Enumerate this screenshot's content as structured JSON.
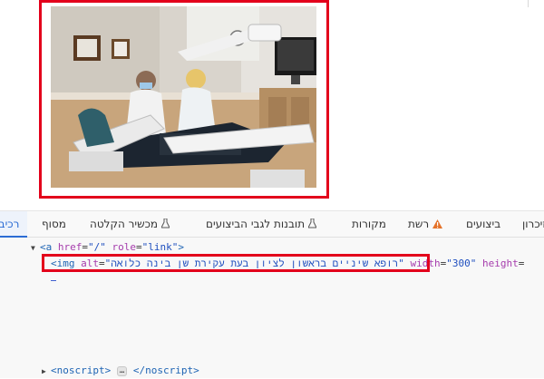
{
  "page": {
    "photo": {
      "description_icon": "dental-clinic-photo"
    }
  },
  "devtools": {
    "tabs": [
      {
        "label": "רכיבי",
        "active": true
      },
      {
        "label": "מסוף"
      },
      {
        "label": "מכשיר הקלטה",
        "icon": "flask-icon"
      },
      {
        "label": "תובנות לגבי הביצועים",
        "icon": "flask-icon"
      },
      {
        "label": "מקורות"
      },
      {
        "label": "רשת",
        "icon": "warning-icon"
      },
      {
        "label": "ביצועים"
      },
      {
        "label": "זיכרון"
      }
    ],
    "dom": {
      "a_line": {
        "tag_open": "<a",
        "href_attr": "href",
        "href_val": "\"/\"",
        "role_attr": "role",
        "role_val": "\"link\"",
        "close": ">"
      },
      "img_line": {
        "tag_open": "<img",
        "alt_attr": "alt",
        "alt_val": "\"רופא שיניים בראשון לציון בעת עקירת שן בינה כלואה\"",
        "width_attr": "width",
        "width_val": "\"300\"",
        "height_attr": "height"
      },
      "noscript_line": {
        "open": "<noscript>",
        "ellipsis": "…",
        "close": "</noscript>"
      }
    }
  },
  "colors": {
    "highlight_border": "#e3001b",
    "tag": "#1e64b4",
    "attr": "#a63dad",
    "value": "#1f4fbf",
    "active_tab": "#2b6cd4"
  }
}
